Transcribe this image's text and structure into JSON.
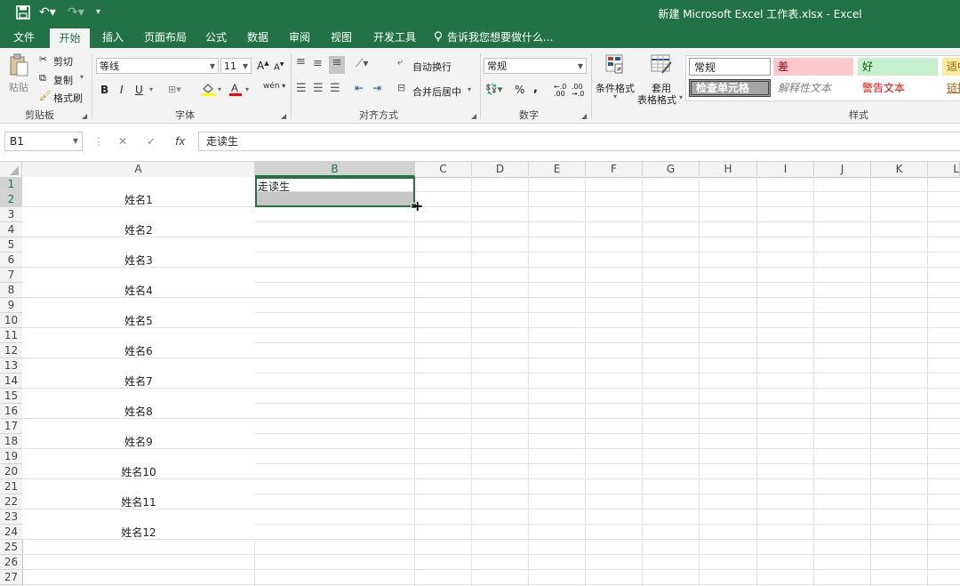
{
  "app": {
    "window_title": "新建 Microsoft Excel 工作表.xlsx - Excel",
    "qa_icons": [
      "save-icon",
      "undo-icon",
      "redo-icon",
      "customize-icon"
    ]
  },
  "tabs": {
    "file": "文件",
    "home": "开始",
    "insert": "插入",
    "layout": "页面布局",
    "formulas": "公式",
    "data": "数据",
    "review": "审阅",
    "view": "视图",
    "developer": "开发工具",
    "tell_me": "告诉我您想要做什么..."
  },
  "ribbon": {
    "clipboard": {
      "label": "剪贴板",
      "paste": "粘贴",
      "cut": "剪切",
      "copy": "复制",
      "format_painter": "格式刷"
    },
    "font": {
      "label": "字体",
      "name": "等线",
      "size": "11",
      "bold": "B",
      "italic": "I",
      "underline": "U",
      "grow": "A",
      "shrink": "A",
      "wen": "wén"
    },
    "alignment": {
      "label": "对齐方式",
      "wrap_text": "自动换行",
      "merge_center": "合并后居中"
    },
    "number": {
      "label": "数字",
      "format": "常规",
      "percent": "%",
      "comma": ","
    },
    "styles_group": {
      "label": "样式",
      "conditional": "条件格式",
      "table_line1": "套用",
      "table_line2": "表格格式"
    },
    "styles": {
      "normal": "常规",
      "bad": "差",
      "good": "好",
      "neutral": "适中",
      "check_cell": "检查单元格",
      "explanatory": "解释性文本",
      "warning": "警告文本",
      "link": "链接"
    },
    "colors": {
      "fill_accent": "#ffff00",
      "font_accent": "#ff0000"
    }
  },
  "formula_bar": {
    "name_box": "B1",
    "content": "走读生",
    "fx": "fx"
  },
  "grid": {
    "columns": [
      "A",
      "B",
      "C",
      "D",
      "E",
      "F",
      "G",
      "H",
      "I",
      "J",
      "K",
      "L"
    ],
    "selected_column": "B",
    "rows": [
      "1",
      "2",
      "3",
      "4",
      "5",
      "6",
      "7",
      "8",
      "9",
      "10",
      "11",
      "12",
      "13",
      "14",
      "15",
      "16",
      "17",
      "18",
      "19",
      "20",
      "21",
      "22",
      "23",
      "24",
      "25",
      "26",
      "27"
    ],
    "column_a": [
      "姓名1",
      "姓名2",
      "姓名3",
      "姓名4",
      "姓名5",
      "姓名6",
      "姓名7",
      "姓名8",
      "姓名9",
      "姓名10",
      "姓名11",
      "姓名12"
    ],
    "b1_value": "走读生"
  },
  "theme": {
    "accent": "#217346"
  }
}
